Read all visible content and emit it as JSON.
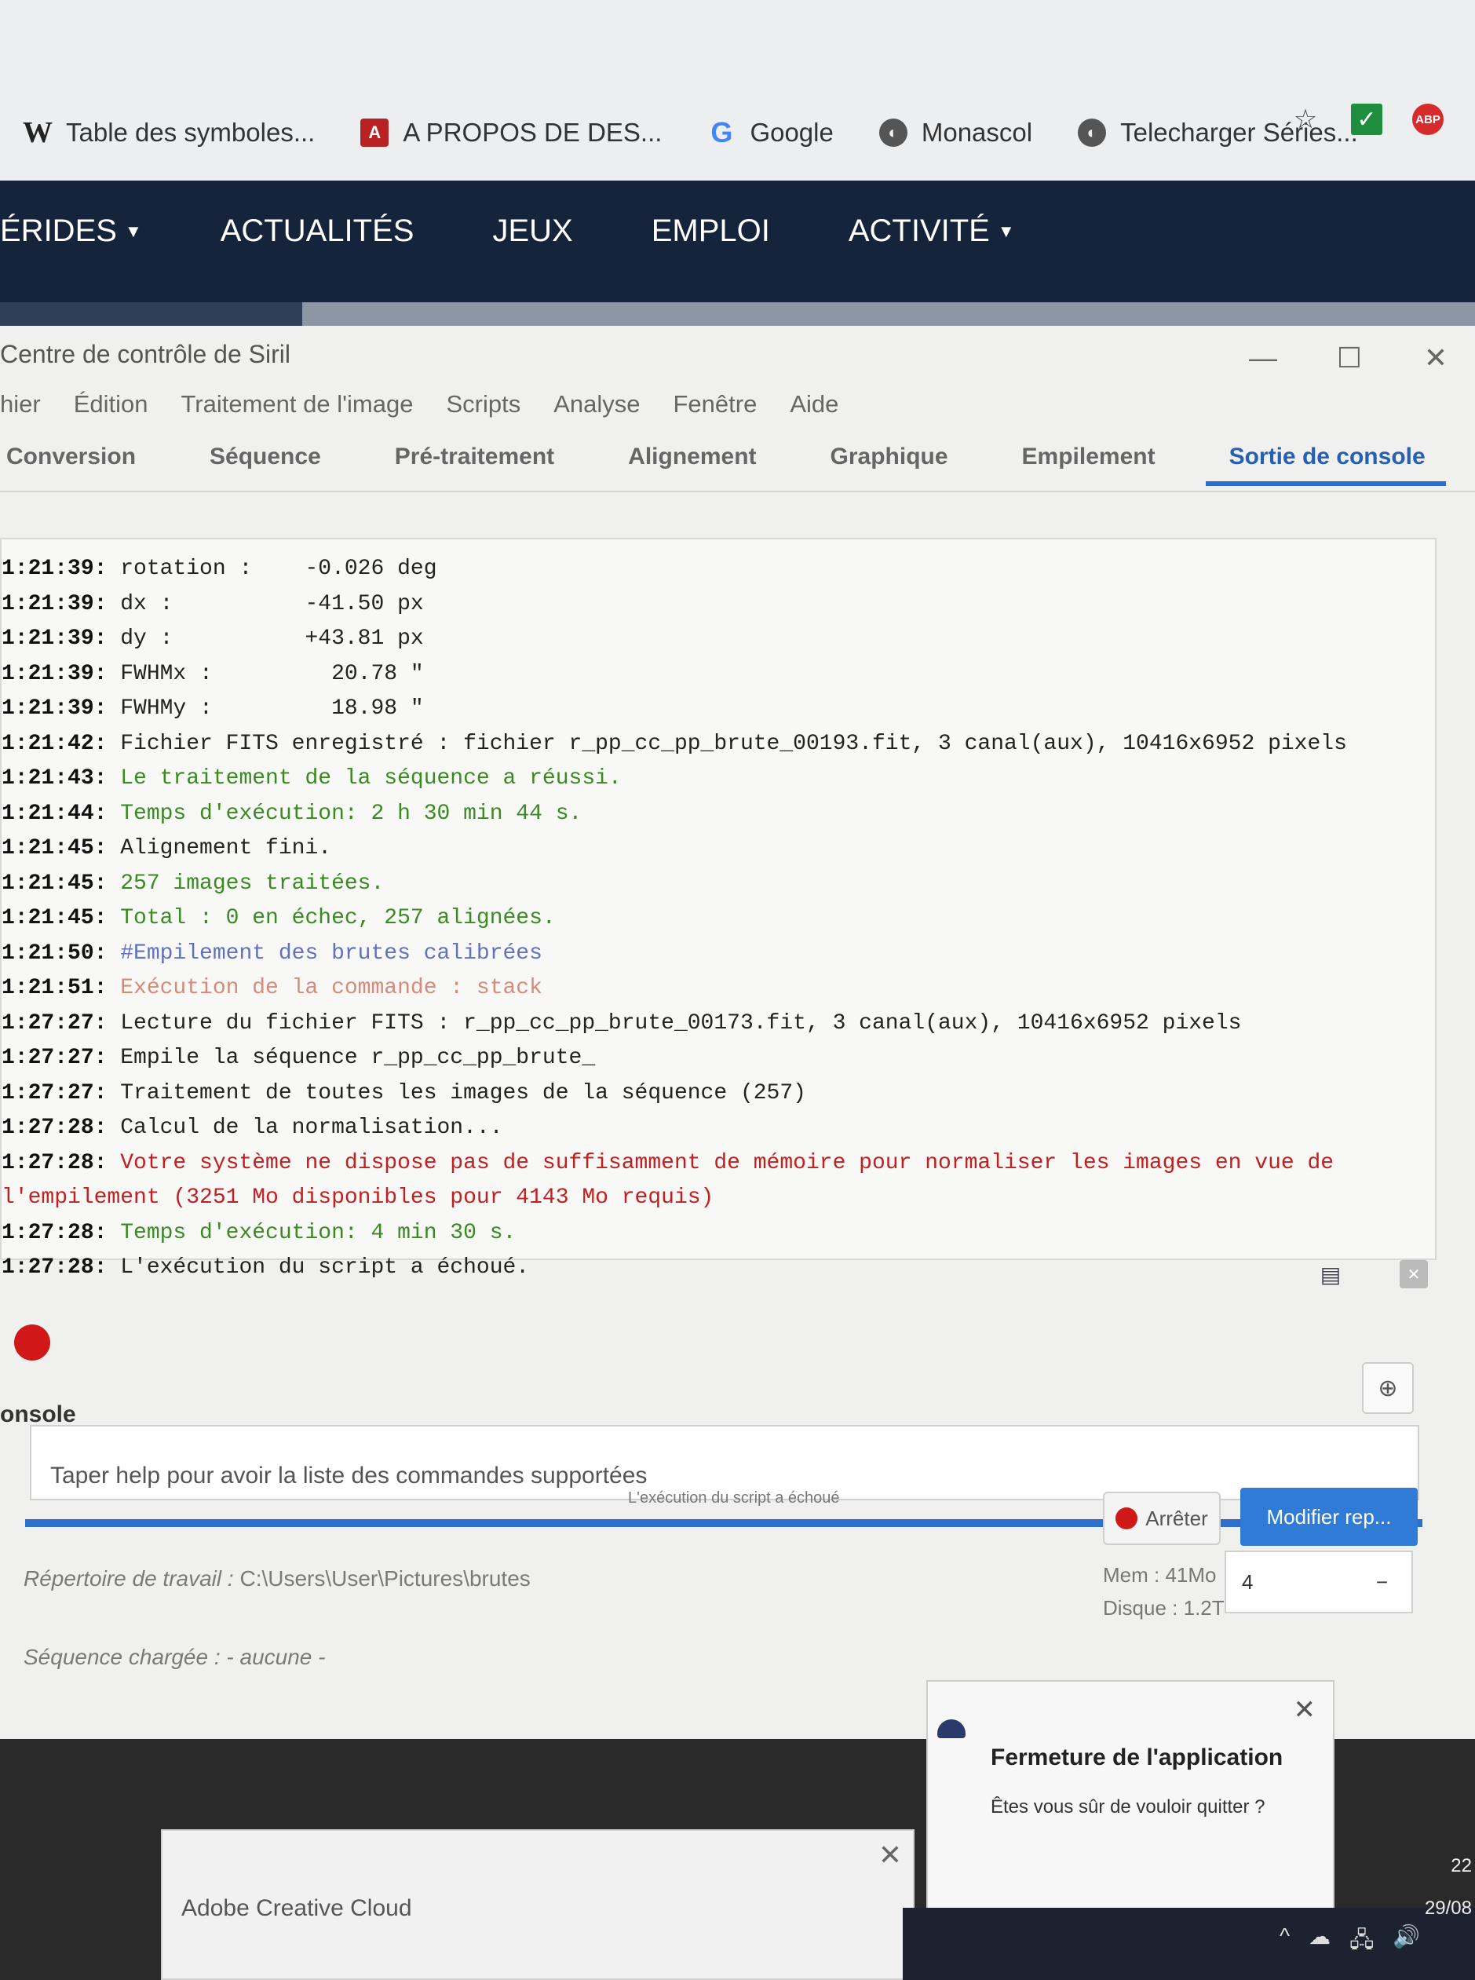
{
  "browser": {
    "bookmarks": [
      {
        "icon": "wikipedia-icon",
        "glyph": "W",
        "label": "Table des symboles..."
      },
      {
        "icon": "apropos-icon",
        "glyph": "A",
        "label": "A PROPOS DE DES..."
      },
      {
        "icon": "google-icon",
        "glyph": "G",
        "label": "Google"
      },
      {
        "icon": "globe-icon",
        "glyph": "◐",
        "label": "Monascol"
      },
      {
        "icon": "globe-icon",
        "glyph": "◐",
        "label": "Telecharger Séries..."
      }
    ],
    "extensions": {
      "star": "☆",
      "check": "✓",
      "abp": "ABP"
    },
    "more": "»"
  },
  "site_nav": {
    "items": [
      {
        "label": "ÉRIDES",
        "caret": true
      },
      {
        "label": "ACTUALITÉS",
        "caret": false
      },
      {
        "label": "JEUX",
        "caret": false
      },
      {
        "label": "EMPLOI",
        "caret": false
      },
      {
        "label": "ACTIVITÉ",
        "caret": true
      }
    ]
  },
  "siril": {
    "title": "Centre de contrôle de Siril",
    "window_controls": {
      "minimize": "—",
      "maximize": "☐",
      "close": "✕"
    },
    "menu": [
      "hier",
      "Édition",
      "Traitement de l'image",
      "Scripts",
      "Analyse",
      "Fenêtre",
      "Aide"
    ],
    "tabs": [
      "Conversion",
      "Séquence",
      "Pré-traitement",
      "Alignement",
      "Graphique",
      "Empilement",
      "Sortie de console"
    ],
    "active_tab": "Sortie de console",
    "log": [
      {
        "ts": "1:21:39:",
        "text": " rotation :    -0.026 deg",
        "color": "normal"
      },
      {
        "ts": "1:21:39:",
        "text": " dx :          -41.50 px",
        "color": "normal"
      },
      {
        "ts": "1:21:39:",
        "text": " dy :          +43.81 px",
        "color": "normal"
      },
      {
        "ts": "1:21:39:",
        "text": " FWHMx :         20.78 \"",
        "color": "normal"
      },
      {
        "ts": "1:21:39:",
        "text": " FWHMy :         18.98 \"",
        "color": "normal"
      },
      {
        "ts": "1:21:42:",
        "text": " Fichier FITS enregistré : fichier r_pp_cc_pp_brute_00193.fit, 3 canal(aux), 10416x6952 pixels",
        "color": "normal"
      },
      {
        "ts": "1:21:43:",
        "text": " Le traitement de la séquence a réussi.",
        "color": "green"
      },
      {
        "ts": "1:21:44:",
        "text": " Temps d'exécution: 2 h 30 min 44 s.",
        "color": "green"
      },
      {
        "ts": "1:21:45:",
        "text": " Alignement fini.",
        "color": "normal"
      },
      {
        "ts": "1:21:45:",
        "text": " 257 images traitées.",
        "color": "green"
      },
      {
        "ts": "1:21:45:",
        "text": " Total : 0 en échec, 257 alignées.",
        "color": "green"
      },
      {
        "ts": "1:21:50:",
        "text": " #Empilement des brutes calibrées",
        "color": "blue"
      },
      {
        "ts": "1:21:51:",
        "text": " Exécution de la commande : stack",
        "color": "salmon"
      },
      {
        "ts": "1:27:27:",
        "text": " Lecture du fichier FITS : r_pp_cc_pp_brute_00173.fit, 3 canal(aux), 10416x6952 pixels",
        "color": "normal"
      },
      {
        "ts": "1:27:27:",
        "text": " Empile la séquence r_pp_cc_pp_brute_",
        "color": "normal"
      },
      {
        "ts": "1:27:27:",
        "text": " Traitement de toutes les images de la séquence (257)",
        "color": "normal"
      },
      {
        "ts": "1:27:28:",
        "text": " Calcul de la normalisation...",
        "color": "normal"
      },
      {
        "ts": "1:27:28:",
        "text": " Votre système ne dispose pas de suffisamment de mémoire pour normaliser les images en vue de",
        "color": "red"
      },
      {
        "ts": "",
        "text": "l'empilement (3251 Mo disponibles pour 4143 Mo requis)",
        "color": "red"
      },
      {
        "ts": "1:27:28:",
        "text": " Temps d'exécution: 4 min 30 s.",
        "color": "green"
      },
      {
        "ts": "1:27:28:",
        "text": " L'exécution du script a échoué.",
        "color": "normal"
      }
    ],
    "colors": {
      "normal": "#222222",
      "green": "#3a8a22",
      "blue": "#6270c0",
      "salmon": "#d78a7a",
      "red": "#c22020",
      "accent": "#2f7bd6"
    },
    "console_label": "onsole",
    "console_placeholder": "Taper help pour avoir la liste des commandes supportées",
    "progress_text": "L'exécution du script a échoué",
    "progress_fraction": 1.0,
    "stop_label": "Arrêter",
    "modify_label": "Modifier rep...",
    "working_dir_label": "Répertoire de travail :",
    "working_dir_value": " C:\\Users\\User\\Pictures\\brutes",
    "sequence_loaded": "Séquence chargée : - aucune -",
    "mem": "Mem : 41Mo",
    "disk": "Disque : 1.2T",
    "threads": "4",
    "threads_minus": "−"
  },
  "quit_dialog": {
    "title": "Fermeture de l'application",
    "message": "Êtes vous sûr de vouloir quitter ?",
    "close": "✕"
  },
  "cc_popup": {
    "title": "Adobe Creative Cloud",
    "close": "✕"
  },
  "taskbar": {
    "tray": [
      "^",
      "☁",
      "🖧",
      "🔊"
    ],
    "time": "22",
    "date": "29/08"
  }
}
